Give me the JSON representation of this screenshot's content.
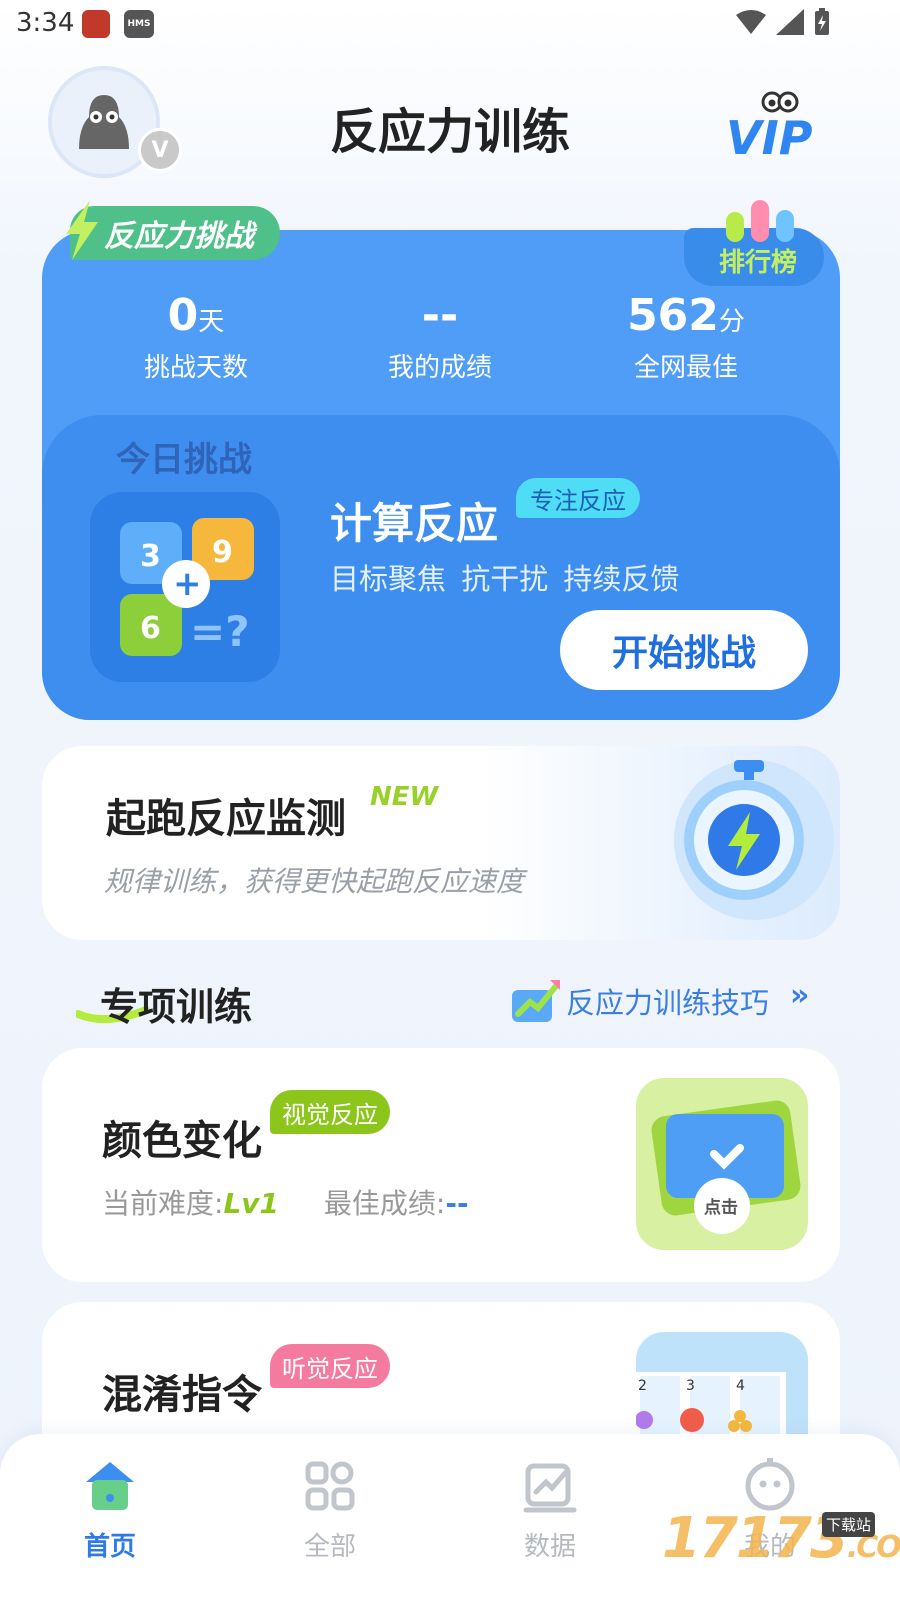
{
  "status_bar": {
    "time": "3:34",
    "hms": "HMS"
  },
  "header": {
    "title": "反应力训练",
    "avatar_badge": "V",
    "vip_label": "VIP"
  },
  "challenge": {
    "tag": "反应力挑战",
    "leaderboard": "排行榜",
    "stats": [
      {
        "value": "0",
        "unit": "天",
        "label": "挑战天数"
      },
      {
        "value": "--",
        "unit": "",
        "label": "我的成绩"
      },
      {
        "value": "562",
        "unit": "分",
        "label": "全网最佳"
      }
    ],
    "today_label": "今日挑战",
    "game": {
      "title": "计算反应",
      "tag": "专注反应",
      "features": "目标聚焦  抗干扰  持续反馈",
      "start_button": "开始挑战",
      "icon_numbers": [
        "3",
        "9",
        "6",
        "+",
        "=?"
      ]
    }
  },
  "start_reaction": {
    "title": "起跑反应监测",
    "new_badge": "NEW",
    "subtitle": "规律训练，获得更快起跑反应速度"
  },
  "special": {
    "title": "专项训练",
    "tips_link": "反应力训练技巧",
    "tips_arrow": "»",
    "items": [
      {
        "title": "颜色变化",
        "tag": "视觉反应",
        "tag_color": "#8cc61b",
        "difficulty_label": "当前难度:",
        "difficulty": "Lv1",
        "best_label": "最佳成绩:",
        "best": "--",
        "thumb_text": "点击"
      },
      {
        "title": "混淆指令",
        "tag": "听觉反应",
        "tag_color": "#f47aa0",
        "thumb_numbers": [
          "2",
          "3",
          "4"
        ]
      }
    ]
  },
  "bottom_nav": [
    {
      "label": "首页",
      "icon": "home-icon",
      "active": true
    },
    {
      "label": "全部",
      "icon": "grid-icon",
      "active": false
    },
    {
      "label": "数据",
      "icon": "chart-icon",
      "active": false
    },
    {
      "label": "我的",
      "icon": "profile-icon",
      "active": false
    }
  ],
  "watermark": {
    "text": "17173",
    "domain": ".COM",
    "tag": "下载站"
  }
}
